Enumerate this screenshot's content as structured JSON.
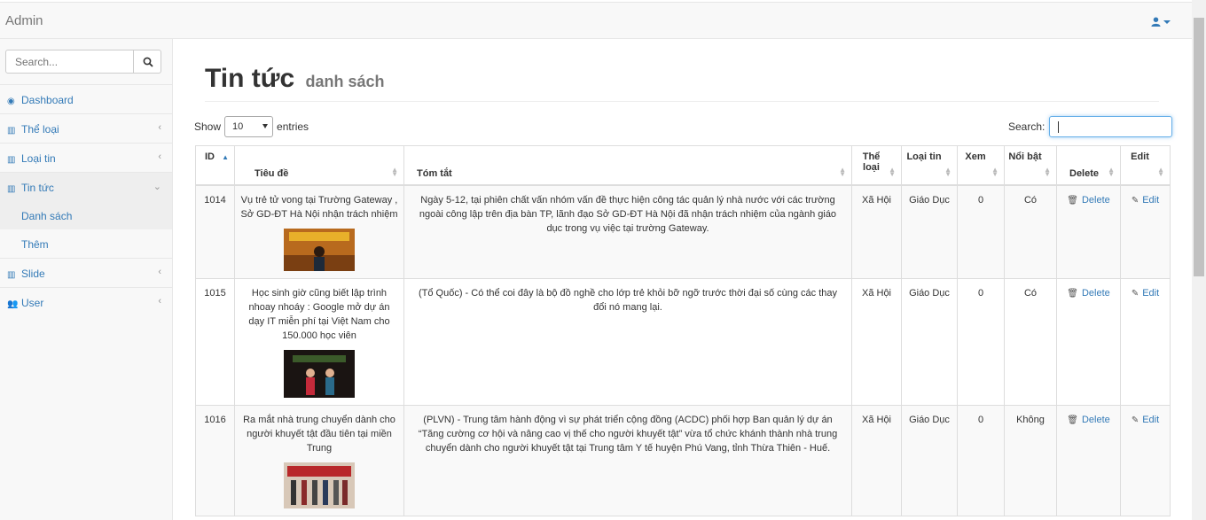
{
  "app": {
    "brand": "Admin"
  },
  "sidebar": {
    "search_placeholder": "Search...",
    "items": [
      {
        "label": "Dashboard",
        "icon": "dashboard-icon"
      },
      {
        "label": "Thể loại",
        "icon": "bar-chart-icon"
      },
      {
        "label": "Loại tin",
        "icon": "bar-chart-icon"
      },
      {
        "label": "Tin tức",
        "icon": "bar-chart-icon"
      },
      {
        "label": "Danh sách"
      },
      {
        "label": "Thêm"
      },
      {
        "label": "Slide",
        "icon": "bar-chart-icon"
      },
      {
        "label": "User",
        "icon": "users-icon"
      }
    ]
  },
  "header": {
    "title": "Tin tức",
    "subtitle": "danh sách"
  },
  "table_controls": {
    "show": "Show",
    "entries": "entries",
    "length_value": "10",
    "search_label": "Search:"
  },
  "table": {
    "columns": [
      "ID",
      "Tiêu đề",
      "Tóm tắt",
      "Thể loại",
      "Loại tin",
      "Xem",
      "Nổi bật",
      "Delete",
      "Edit"
    ],
    "rows": [
      {
        "id": "1014",
        "title": "Vụ trẻ tử vong tại Trường Gateway , Sở GD-ĐT Hà Nội nhận trách nhiệm",
        "summary": "Ngày 5-12, tại phiên chất vấn nhóm vấn đề thực hiện công tác quản lý nhà nước với các trường ngoài công lập trên địa bàn TP, lãnh đạo Sở GD-ĐT Hà Nội đã nhận trách nhiệm của ngành giáo dục trong vụ việc tại trường Gateway.",
        "category": "Xã Hội",
        "type": "Giáo Dục",
        "views": "0",
        "featured": "Có",
        "delete": "Delete",
        "edit": "Edit"
      },
      {
        "id": "1015",
        "title": "Học sinh giờ cũng biết lập trình nhoay nhoáy : Google mở dự án dạy IT miễn phí tại Việt Nam cho 150.000 học viên",
        "summary": "(Tổ Quốc) - Có thể coi đây là bộ đồ nghề cho lớp trẻ khỏi bỡ ngỡ trước thời đại số cùng các thay đổi nó mang lại.",
        "category": "Xã Hội",
        "type": "Giáo Dục",
        "views": "0",
        "featured": "Có",
        "delete": "Delete",
        "edit": "Edit"
      },
      {
        "id": "1016",
        "title": "Ra mắt nhà trung chuyển dành cho người khuyết tật đầu tiên tại miền Trung",
        "summary": "(PLVN) - Trung tâm hành động vì sự phát triển cộng đồng (ACDC) phối hợp Ban quản lý dự án “Tăng cường cơ hội và nâng cao vị thế cho người khuyết tật” vừa tổ chức khánh thành nhà trung chuyển dành cho người khuyết tật tại Trung tâm Y tế huyện Phú Vang, tỉnh Thừa Thiên - Huế.",
        "category": "Xã Hội",
        "type": "Giáo Dục",
        "views": "0",
        "featured": "Không",
        "delete": "Delete",
        "edit": "Edit"
      }
    ]
  },
  "colors": {
    "link": "#337ab7",
    "sidebar_bg": "#f8f8f8",
    "active_bg": "#eeeeee"
  }
}
